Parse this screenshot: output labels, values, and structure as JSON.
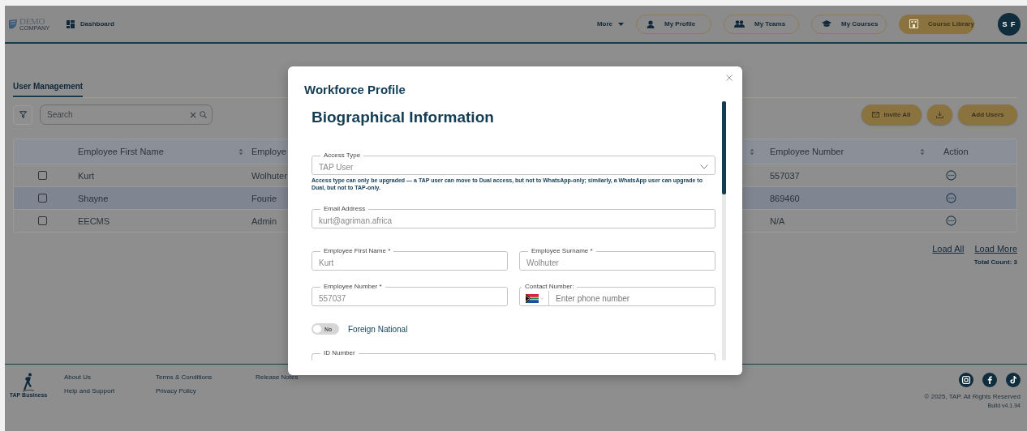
{
  "header": {
    "logo": "DEMO",
    "logo_sub": "COMPANY",
    "nav": [
      {
        "label": "Dashboard"
      }
    ],
    "more": "More",
    "buttons": [
      {
        "label": "My Profile",
        "kind": "outline"
      },
      {
        "label": "My Teams",
        "kind": "outline"
      },
      {
        "label": "My Courses",
        "kind": "outline"
      },
      {
        "label": "Course Library",
        "kind": "filled"
      }
    ],
    "avatar": "S F"
  },
  "user_management": {
    "tabs": [
      {
        "label": "User Management",
        "selected": true
      }
    ],
    "search": {
      "placeholder": "Search"
    },
    "actions": [
      {
        "kind": "mail",
        "label": "Invite All"
      },
      {
        "kind": "download"
      },
      {
        "kind": "text",
        "label": "Add Users"
      }
    ],
    "table": {
      "columns": [
        {
          "label": "Employee First Name",
          "sortable": true
        },
        {
          "label": "Employe",
          "sortable": true
        },
        {
          "label": "Employee Number",
          "sortable": true
        },
        {
          "label": "Action",
          "sortable": false
        }
      ],
      "rows": [
        {
          "checked": false,
          "highlighted": false,
          "cells": [
            "Kurt",
            "Wolhuter",
            "557037"
          ]
        },
        {
          "checked": false,
          "highlighted": true,
          "cells": [
            "Shayne",
            "Fourie",
            "869460"
          ]
        },
        {
          "checked": false,
          "highlighted": false,
          "cells": [
            "EECMS",
            "Admin",
            "N/A"
          ]
        }
      ]
    },
    "pager": {
      "links": [
        "Load All",
        "Load More"
      ],
      "total": "Total Count: 3"
    }
  },
  "modal": {
    "title": "Workforce Profile",
    "section": "Biographical Information",
    "rows": [
      [
        {
          "kind": "select",
          "label": "Access Type",
          "value": "TAP User",
          "helper": "Access type can only be upgraded — a TAP user can move to Dual access, but not to WhatsApp-only; similarly, a WhatsApp user can upgrade to Dual, but not to TAP-only."
        }
      ],
      [
        {
          "kind": "text",
          "label": "Email Address",
          "value": "kurt@agriman.africa"
        }
      ],
      [
        {
          "kind": "text",
          "label": "Employee First Name *",
          "value": "Kurt"
        },
        {
          "kind": "text",
          "label": "Employee Surname *",
          "value": "Wolhuter"
        }
      ],
      [
        {
          "kind": "text",
          "label": "Employee Number *",
          "value": "557037"
        },
        {
          "kind": "phone",
          "label": "Contact Number:",
          "placeholder": "Enter phone number"
        }
      ],
      [
        {
          "kind": "toggle",
          "label": "Foreign National",
          "on": false,
          "state_text": "No"
        }
      ],
      [
        {
          "kind": "text",
          "label": "ID Number"
        }
      ]
    ]
  },
  "footer": {
    "logo_text": "TAP Business",
    "link_columns": [
      [
        "About Us",
        "Help and Support"
      ],
      [
        "Terms & Conditions",
        "Privacy Policy"
      ],
      [
        "Release Notes"
      ]
    ],
    "copyright": "© 2025, TAP. All Rights Reserved",
    "build": "Build v4.1.94"
  }
}
